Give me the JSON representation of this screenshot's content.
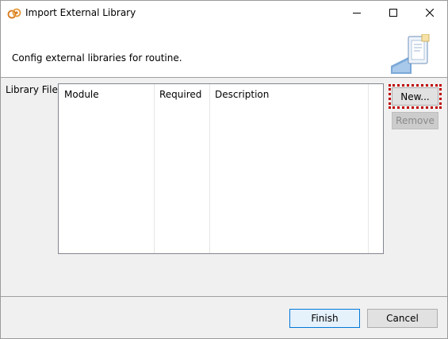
{
  "window": {
    "title": "Import External Library",
    "title_icon": "eclipse-talend-icon",
    "controls": {
      "minimize_icon": "minimize-icon",
      "maximize_icon": "maximize-icon",
      "close_icon": "close-icon"
    }
  },
  "header": {
    "message": "Config external libraries for routine.",
    "image_icon": "wizard-document-icon"
  },
  "library": {
    "label": "Library File:",
    "columns": [
      "Module",
      "Required",
      "Description"
    ],
    "rows": []
  },
  "buttons": {
    "new_label": "New...",
    "remove_label": "Remove",
    "finish_label": "Finish",
    "cancel_label": "Cancel"
  },
  "colors": {
    "focus_highlight": "#c00000",
    "default_button_border": "#0078d7"
  }
}
